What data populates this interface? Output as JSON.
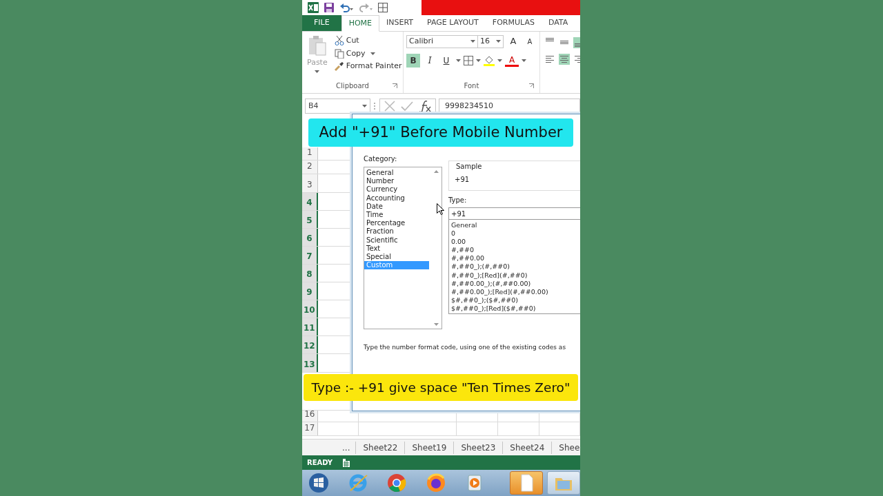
{
  "ribbon_tabs": [
    {
      "label": "FILE",
      "kind": "file",
      "selected": false
    },
    {
      "label": "HOME",
      "kind": "tab",
      "selected": true
    },
    {
      "label": "INSERT",
      "kind": "tab",
      "selected": false
    },
    {
      "label": "PAGE LAYOUT",
      "kind": "tab",
      "selected": false
    },
    {
      "label": "FORMULAS",
      "kind": "tab",
      "selected": false
    },
    {
      "label": "DATA",
      "kind": "tab",
      "selected": false
    }
  ],
  "clipboard": {
    "paste": "Paste",
    "cut": "Cut",
    "copy": "Copy",
    "format_painter": "Format Painter",
    "label": "Clipboard"
  },
  "font": {
    "name": "Calibri",
    "size": "16",
    "grow": "A",
    "shrink": "A",
    "label": "Font",
    "styles": [
      {
        "label": "B",
        "kind": "bold",
        "on": true
      },
      {
        "label": "I",
        "kind": "italic",
        "on": false
      },
      {
        "label": "U",
        "kind": "underline",
        "on": false
      }
    ],
    "font_color": "A"
  },
  "alignment": [
    {
      "kind": "top",
      "on": false
    },
    {
      "kind": "middle",
      "on": false
    },
    {
      "kind": "bottom",
      "on": true
    },
    {
      "kind": "left",
      "on": false
    },
    {
      "kind": "center",
      "on": true
    },
    {
      "kind": "right",
      "on": false
    }
  ],
  "formula_bar": {
    "name_box": "B4",
    "value": "9998234510"
  },
  "rows": [
    {
      "label": "1",
      "selected": false
    },
    {
      "label": "2",
      "selected": false
    },
    {
      "label": "3",
      "selected": false
    },
    {
      "label": "4",
      "selected": true
    },
    {
      "label": "5",
      "selected": true
    },
    {
      "label": "6",
      "selected": true
    },
    {
      "label": "7",
      "selected": true
    },
    {
      "label": "8",
      "selected": true
    },
    {
      "label": "9",
      "selected": true
    },
    {
      "label": "10",
      "selected": true
    },
    {
      "label": "11",
      "selected": true
    },
    {
      "label": "12",
      "selected": true
    },
    {
      "label": "13",
      "selected": true
    },
    {
      "label": "16",
      "selected": false
    },
    {
      "label": "17",
      "selected": false
    }
  ],
  "dialog": {
    "category_label": "Category:",
    "categories": [
      {
        "label": "General",
        "selected": false
      },
      {
        "label": "Number",
        "selected": false
      },
      {
        "label": "Currency",
        "selected": false
      },
      {
        "label": "Accounting",
        "selected": false
      },
      {
        "label": "Date",
        "selected": false
      },
      {
        "label": "Time",
        "selected": false
      },
      {
        "label": "Percentage",
        "selected": false
      },
      {
        "label": "Fraction",
        "selected": false
      },
      {
        "label": "Scientific",
        "selected": false
      },
      {
        "label": "Text",
        "selected": false
      },
      {
        "label": "Special",
        "selected": false
      },
      {
        "label": "Custom",
        "selected": true
      }
    ],
    "sample_label": "Sample",
    "sample": "+91",
    "type_label": "Type:",
    "type_value": "+91 ",
    "formats": [
      "General",
      "0",
      "0.00",
      "#,##0",
      "#,##0.00",
      "#,##0_);(#,##0)",
      "#,##0_);[Red](#,##0)",
      "#,##0.00_);(#,##0.00)",
      "#,##0.00_);[Red](#,##0.00)",
      "$#,##0_);($#,##0)",
      "$#,##0_);[Red]($#,##0)"
    ],
    "hint": "Type the number format code, using one of the existing codes as"
  },
  "captions": [
    {
      "text": "Add \"+91\" Before Mobile Number",
      "kind": "cyan"
    },
    {
      "text": "Type :-  +91 give space \"Ten Times Zero\"",
      "kind": "yellow"
    }
  ],
  "sheet_tabs": [
    "...",
    "Sheet22",
    "Sheet19",
    "Sheet23",
    "Sheet24",
    "Shee"
  ],
  "status": "READY",
  "taskbar": [
    {
      "kind": "start",
      "active": false
    },
    {
      "kind": "ie",
      "active": false
    },
    {
      "kind": "chrome",
      "active": false
    },
    {
      "kind": "firefox",
      "active": false
    },
    {
      "kind": "media",
      "active": false
    },
    {
      "kind": "file",
      "active": true
    },
    {
      "kind": "folder",
      "active": false
    }
  ]
}
